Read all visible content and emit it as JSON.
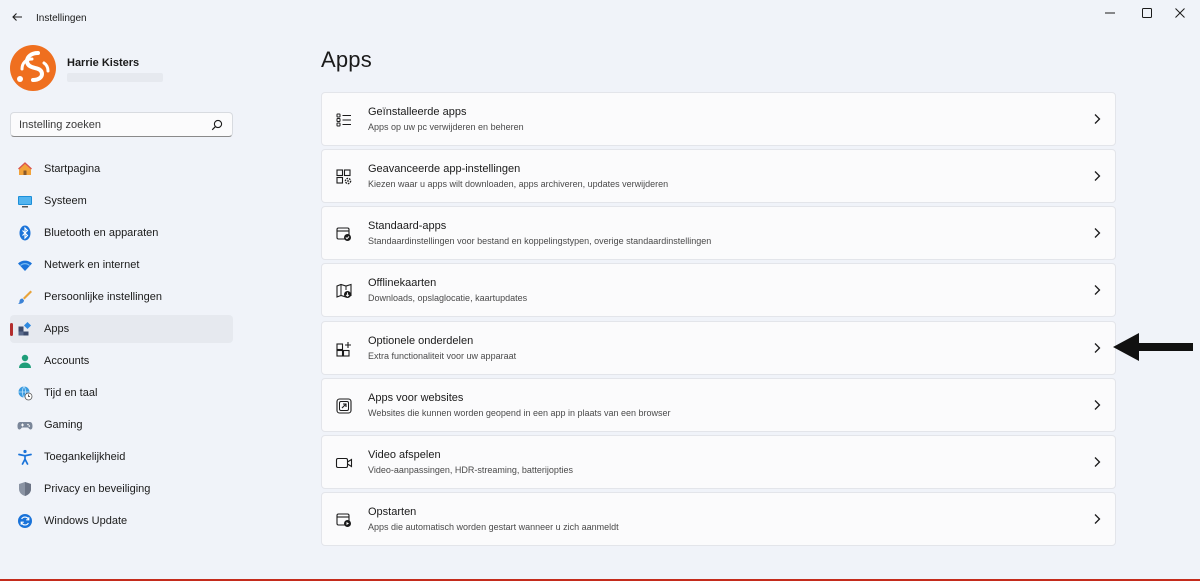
{
  "window": {
    "title": "Instellingen"
  },
  "profile": {
    "name": "Harrie Kisters"
  },
  "search": {
    "placeholder": "Instelling zoeken"
  },
  "sidebar": {
    "items": [
      {
        "label": "Startpagina",
        "icon": "home-icon",
        "active": false
      },
      {
        "label": "Systeem",
        "icon": "system-monitor-icon",
        "active": false
      },
      {
        "label": "Bluetooth en apparaten",
        "icon": "bluetooth-icon",
        "active": false
      },
      {
        "label": "Netwerk en internet",
        "icon": "wifi-icon",
        "active": false
      },
      {
        "label": "Persoonlijke instellingen",
        "icon": "brush-icon",
        "active": false
      },
      {
        "label": "Apps",
        "icon": "apps-icon",
        "active": true
      },
      {
        "label": "Accounts",
        "icon": "person-icon",
        "active": false
      },
      {
        "label": "Tijd en taal",
        "icon": "globe-clock-icon",
        "active": false
      },
      {
        "label": "Gaming",
        "icon": "gamepad-icon",
        "active": false
      },
      {
        "label": "Toegankelijkheid",
        "icon": "accessibility-icon",
        "active": false
      },
      {
        "label": "Privacy en beveiliging",
        "icon": "shield-icon",
        "active": false
      },
      {
        "label": "Windows Update",
        "icon": "update-icon",
        "active": false
      }
    ]
  },
  "main": {
    "title": "Apps",
    "cards": [
      {
        "title": "Geïnstalleerde apps",
        "subtitle": "Apps op uw pc verwijderen en beheren",
        "icon": "list-icon"
      },
      {
        "title": "Geavanceerde app-instellingen",
        "subtitle": "Kiezen waar u apps wilt downloaden, apps archiveren, updates verwijderen",
        "icon": "app-settings-icon"
      },
      {
        "title": "Standaard-apps",
        "subtitle": "Standaardinstellingen voor bestand en koppelingstypen, overige standaardinstellingen",
        "icon": "default-apps-icon"
      },
      {
        "title": "Offlinekaarten",
        "subtitle": "Downloads, opslaglocatie, kaartupdates",
        "icon": "offline-map-icon"
      },
      {
        "title": "Optionele onderdelen",
        "subtitle": "Extra functionaliteit voor uw apparaat",
        "icon": "add-grid-icon"
      },
      {
        "title": "Apps voor websites",
        "subtitle": "Websites die kunnen worden geopend in een app in plaats van een browser",
        "icon": "open-link-icon"
      },
      {
        "title": "Video afspelen",
        "subtitle": "Video-aanpassingen, HDR-streaming, batterijopties",
        "icon": "video-icon"
      },
      {
        "title": "Opstarten",
        "subtitle": "Apps die automatisch worden gestart wanneer u zich aanmeldt",
        "icon": "startup-icon"
      }
    ]
  },
  "colors": {
    "accent": "#0067c0",
    "active_indicator": "#b32d2d",
    "avatar": "#ef6f1f"
  }
}
